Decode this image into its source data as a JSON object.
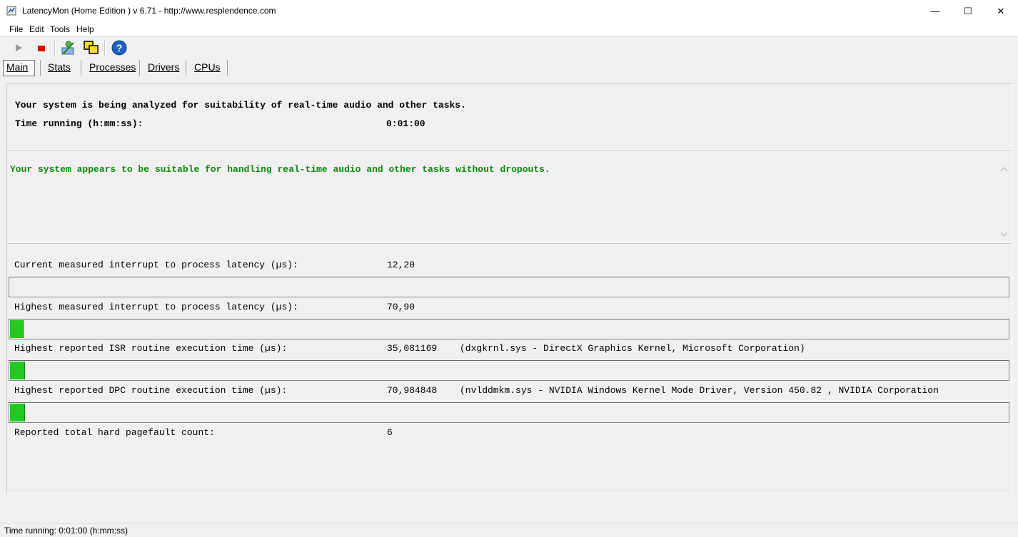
{
  "window": {
    "title": "LatencyMon  (Home Edition )  v 6.71 - http://www.resplendence.com",
    "min_glyph": "—",
    "max_glyph": "☐",
    "close_glyph": "✕"
  },
  "menu": [
    "File",
    "Edit",
    "Tools",
    "Help"
  ],
  "toolbar": {
    "icons": [
      "play-icon",
      "stop-icon",
      "user-icon",
      "windows-icon",
      "help-icon"
    ],
    "stop_color": "#e00000",
    "help_color": "#1f5fbf"
  },
  "tabs": [
    "Main",
    "Stats",
    "Processes",
    "Drivers",
    "CPUs"
  ],
  "summary": {
    "headline": "Your system is being analyzed for suitability of real-time audio and other tasks.",
    "time_label": "Time running (h:mm:ss):",
    "time_value": "0:01:00"
  },
  "verdict": {
    "text": "Your system appears to be suitable for handling real-time audio and other tasks without dropouts.",
    "color": "#0a8a0a"
  },
  "metrics": [
    {
      "label": "Current measured interrupt to process latency (µs):",
      "value": "12,20",
      "detail": "",
      "bar_fraction": 0.0
    },
    {
      "label": "Highest measured interrupt to process latency (µs):",
      "value": "70,90",
      "detail": "",
      "bar_fraction": 0.013
    },
    {
      "label": "Highest reported ISR routine execution time (µs):",
      "value": "35,081169",
      "detail": "(dxgkrnl.sys - DirectX Graphics Kernel, Microsoft Corporation)",
      "bar_fraction": 0.014
    },
    {
      "label": "Highest reported DPC routine execution time (µs):",
      "value": "70,984848",
      "detail": "(nvlddmkm.sys - NVIDIA Windows Kernel Mode Driver, Version 450.82 , NVIDIA Corporation",
      "bar_fraction": 0.014
    }
  ],
  "pagefault": {
    "label": "Reported total hard pagefault count:",
    "value": "6"
  },
  "status": "Time running: 0:01:00  (h:mm:ss)",
  "bar_color": "#1ecb1e"
}
